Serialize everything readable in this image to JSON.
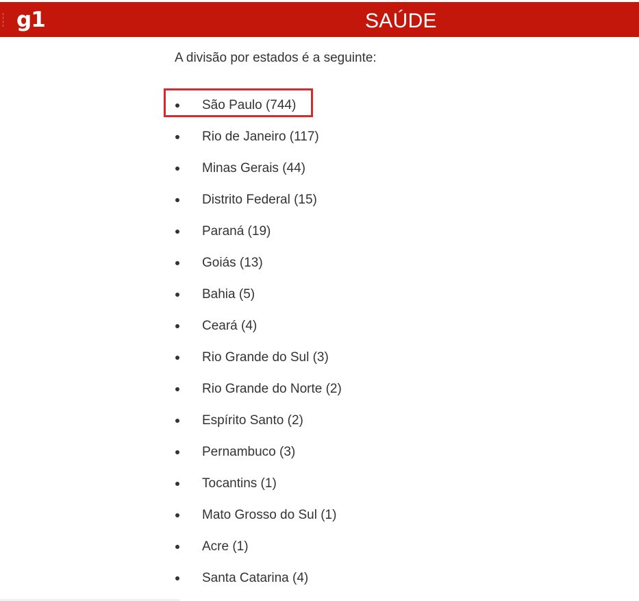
{
  "header": {
    "logo_text": "g1",
    "section_title": "SAÚDE",
    "background_color": "#c4170c"
  },
  "article": {
    "intro": "A divisão por estados é a seguinte:",
    "states": [
      {
        "label": "São Paulo (744)",
        "highlighted": true
      },
      {
        "label": "Rio de Janeiro (117)"
      },
      {
        "label": "Minas Gerais (44)"
      },
      {
        "label": "Distrito Federal (15)"
      },
      {
        "label": "Paraná (19)"
      },
      {
        "label": "Goiás (13)"
      },
      {
        "label": "Bahia (5)"
      },
      {
        "label": "Ceará (4)"
      },
      {
        "label": "Rio Grande do Sul (3)"
      },
      {
        "label": "Rio Grande do Norte (2)"
      },
      {
        "label": "Espírito Santo (2)"
      },
      {
        "label": "Pernambuco (3)"
      },
      {
        "label": "Tocantins (1)"
      },
      {
        "label": "Mato Grosso do Sul (1)"
      },
      {
        "label": "Acre (1)"
      },
      {
        "label": "Santa Catarina (4)"
      }
    ]
  },
  "annotation": {
    "highlight_color": "#e0262a"
  }
}
